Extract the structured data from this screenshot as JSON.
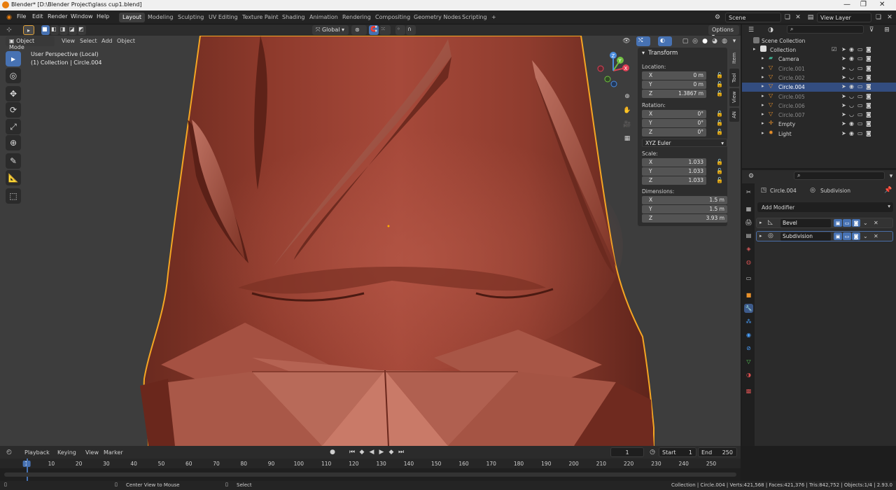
{
  "window": {
    "title": "Blender* [D:\\Blender Project\\glass cup1.blend]"
  },
  "menu": {
    "items": [
      "File",
      "Edit",
      "Render",
      "Window",
      "Help"
    ]
  },
  "workspaces": [
    "Layout",
    "Modeling",
    "Sculpting",
    "UV Editing",
    "Texture Paint",
    "Shading",
    "Animation",
    "Rendering",
    "Compositing",
    "Geometry Nodes",
    "Scripting",
    "+"
  ],
  "scene": {
    "label": "Scene",
    "view_layer": "View Layer"
  },
  "viewport_header": {
    "transform_orientation": "Global",
    "options": "Options",
    "mode": "Object Mode",
    "menus": [
      "View",
      "Select",
      "Add",
      "Object"
    ]
  },
  "viewport": {
    "perspective": "User Perspective (Local)",
    "collection_info": "(1) Collection | Circle.004"
  },
  "gizmo": {
    "x": "X",
    "y": "Y",
    "z": "Z"
  },
  "npanel": {
    "title": "Transform",
    "location_label": "Location:",
    "location": [
      {
        "ax": "X",
        "v": "0 m"
      },
      {
        "ax": "Y",
        "v": "0 m"
      },
      {
        "ax": "Z",
        "v": "1.3867 m"
      }
    ],
    "rotation_label": "Rotation:",
    "rotation": [
      {
        "ax": "X",
        "v": "0°"
      },
      {
        "ax": "Y",
        "v": "0°"
      },
      {
        "ax": "Z",
        "v": "0°"
      }
    ],
    "rotation_mode": "XYZ Euler",
    "scale_label": "Scale:",
    "scale": [
      {
        "ax": "X",
        "v": "1.033"
      },
      {
        "ax": "Y",
        "v": "1.033"
      },
      {
        "ax": "Z",
        "v": "1.033"
      }
    ],
    "dimensions_label": "Dimensions:",
    "dimensions": [
      {
        "ax": "X",
        "v": "1.5 m"
      },
      {
        "ax": "Y",
        "v": "1.5 m"
      },
      {
        "ax": "Z",
        "v": "3.93 m"
      }
    ],
    "tabs": [
      "Item",
      "Tool",
      "View",
      "AN"
    ]
  },
  "outliner": {
    "root": "Scene Collection",
    "items": [
      {
        "name": "Collection",
        "type": "collection",
        "selected": false,
        "dim": false
      },
      {
        "name": "Camera",
        "type": "camera",
        "selected": false,
        "dim": false
      },
      {
        "name": "Circle.001",
        "type": "mesh",
        "selected": false,
        "dim": true
      },
      {
        "name": "Circle.002",
        "type": "mesh",
        "selected": false,
        "dim": true
      },
      {
        "name": "Circle.004",
        "type": "mesh",
        "selected": true,
        "dim": false
      },
      {
        "name": "Circle.005",
        "type": "mesh",
        "selected": false,
        "dim": true
      },
      {
        "name": "Circle.006",
        "type": "mesh",
        "selected": false,
        "dim": true
      },
      {
        "name": "Circle.007",
        "type": "mesh",
        "selected": false,
        "dim": true
      },
      {
        "name": "Empty",
        "type": "empty",
        "selected": false,
        "dim": false
      },
      {
        "name": "Light",
        "type": "light",
        "selected": false,
        "dim": false
      }
    ]
  },
  "properties": {
    "object": "Circle.004",
    "modifier_context": "Subdivision",
    "add_modifier": "Add Modifier",
    "modifiers": [
      "Bevel",
      "Subdivision"
    ]
  },
  "timeline": {
    "menus": [
      "Playback",
      "Keying",
      "View",
      "Marker"
    ],
    "current_frame": "1",
    "start_label": "Start",
    "start": "1",
    "end_label": "End",
    "end": "250",
    "ruler": [
      "1",
      "10",
      "20",
      "30",
      "40",
      "50",
      "60",
      "70",
      "80",
      "90",
      "100",
      "110",
      "120",
      "130",
      "140",
      "150",
      "160",
      "170",
      "180",
      "190",
      "200",
      "210",
      "220",
      "230",
      "240",
      "250"
    ]
  },
  "statusbar": {
    "hint1": "Center View to Mouse",
    "hint2": "Select",
    "stats": "Collection | Circle.004 | Verts:421,568 | Faces:421,376 | Tris:842,752 | Objects:1/4 | 2.93.0"
  },
  "colors": {
    "accent": "#4772b3",
    "selection_outline": "#f5a623",
    "object": "#a9483b",
    "viewport_bg": "#3d3d3d"
  }
}
